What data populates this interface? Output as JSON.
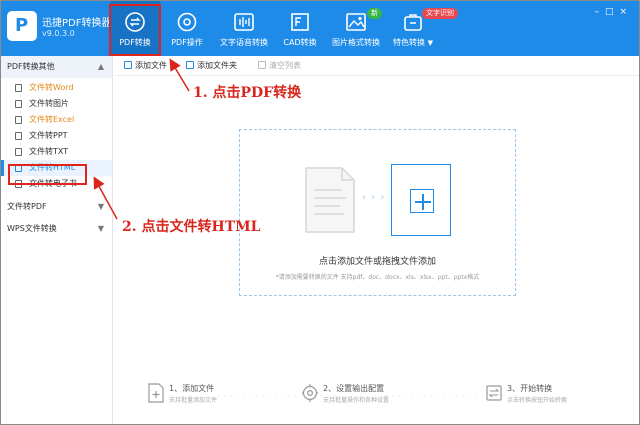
{
  "app": {
    "logo_letter": "P",
    "name": "迅捷PDF转换器",
    "version": "v9.0.3.0"
  },
  "nav": {
    "tabs": [
      {
        "label": "PDF转换",
        "icon": "convert-icon",
        "active": true
      },
      {
        "label": "PDF操作",
        "icon": "settings-icon"
      },
      {
        "label": "文字语音转换",
        "icon": "voice-icon"
      },
      {
        "label": "CAD转换",
        "icon": "cad-icon"
      },
      {
        "label": "图片格式转换",
        "icon": "image-icon"
      },
      {
        "label": "特色转换",
        "icon": "special-icon",
        "dropdown": "▼"
      }
    ],
    "badge_new": "新",
    "badge_ocr": "文字识别"
  },
  "window": {
    "controls": "–□×"
  },
  "sidebar": {
    "group1": {
      "label": "PDF转换其他",
      "chevron": "▲"
    },
    "items": [
      {
        "label": "文件转Word",
        "style": "orange"
      },
      {
        "label": "文件转图片",
        "style": ""
      },
      {
        "label": "文件转Excel",
        "style": "orange"
      },
      {
        "label": "文件转PPT",
        "style": ""
      },
      {
        "label": "文件转TXT",
        "style": ""
      },
      {
        "label": "文件转HTML",
        "style": "sel"
      },
      {
        "label": "文件转电子书",
        "style": ""
      }
    ],
    "group2": {
      "label": "文件转PDF",
      "chevron": "▼"
    },
    "group3": {
      "label": "WPS文件转换",
      "chevron": "▼"
    }
  },
  "toolbar": {
    "add_file": "添加文件",
    "add_folder": "添加文件夹",
    "clear_list": "清空列表"
  },
  "dropzone": {
    "arrows": "› › ›",
    "main_text": "点击添加文件或拖拽文件添加",
    "hint": "*请添加需要转换的文件  支持pdf、doc、docx、xls、xlsx、ppt、pptx格式"
  },
  "steps": [
    {
      "title": "1、添加文件",
      "sub": "支持批量添加文件",
      "icon": "add-file-icon"
    },
    {
      "title": "2、设置输出配置",
      "sub": "支持批量操作和各种设置",
      "icon": "gear-icon"
    },
    {
      "title": "3、开始转换",
      "sub": "点击转换按钮开始转换",
      "icon": "convert-icon"
    }
  ],
  "step_dots": "· · · · · · · · · · · · · · · · · · ·",
  "annotations": {
    "first": "1. 点击PDF转换",
    "second": "2. 点击文件转HTML"
  },
  "colors": {
    "primary": "#1f8be8",
    "active_tab": "#1673c6",
    "annotation": "#d9261c",
    "orange": "#e48a17"
  }
}
